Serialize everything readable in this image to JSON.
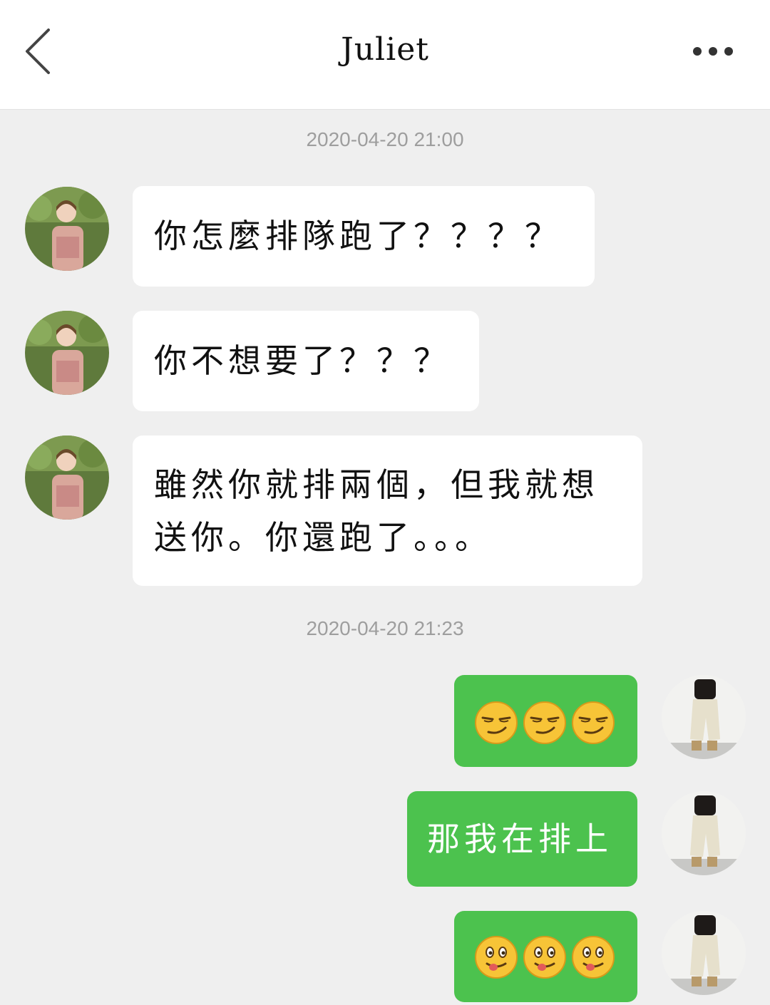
{
  "header": {
    "title": "Juliet",
    "back_icon": "chevron-left-icon",
    "more_icon": "more-dots-icon"
  },
  "timestamps": [
    "2020-04-20 21:00",
    "2020-04-20 21:23"
  ],
  "messages": [
    {
      "side": "in",
      "text": "你怎麼排隊跑了？？？？"
    },
    {
      "side": "in",
      "text": "你不想要了？？？"
    },
    {
      "side": "in",
      "text_line1": "雖然你就排兩個，但我就想",
      "text_line2": "送你。你還跑了。。。"
    },
    {
      "side": "out",
      "emoji": "smirk-emoji",
      "count": 3
    },
    {
      "side": "out",
      "text": "那我在排上"
    },
    {
      "side": "out",
      "emoji": "tongue-emoji",
      "count": 3
    }
  ],
  "colors": {
    "background": "#efefef",
    "incoming_bubble": "#ffffff",
    "outgoing_bubble": "#4cc24e",
    "timestamp": "#9e9e9e"
  }
}
